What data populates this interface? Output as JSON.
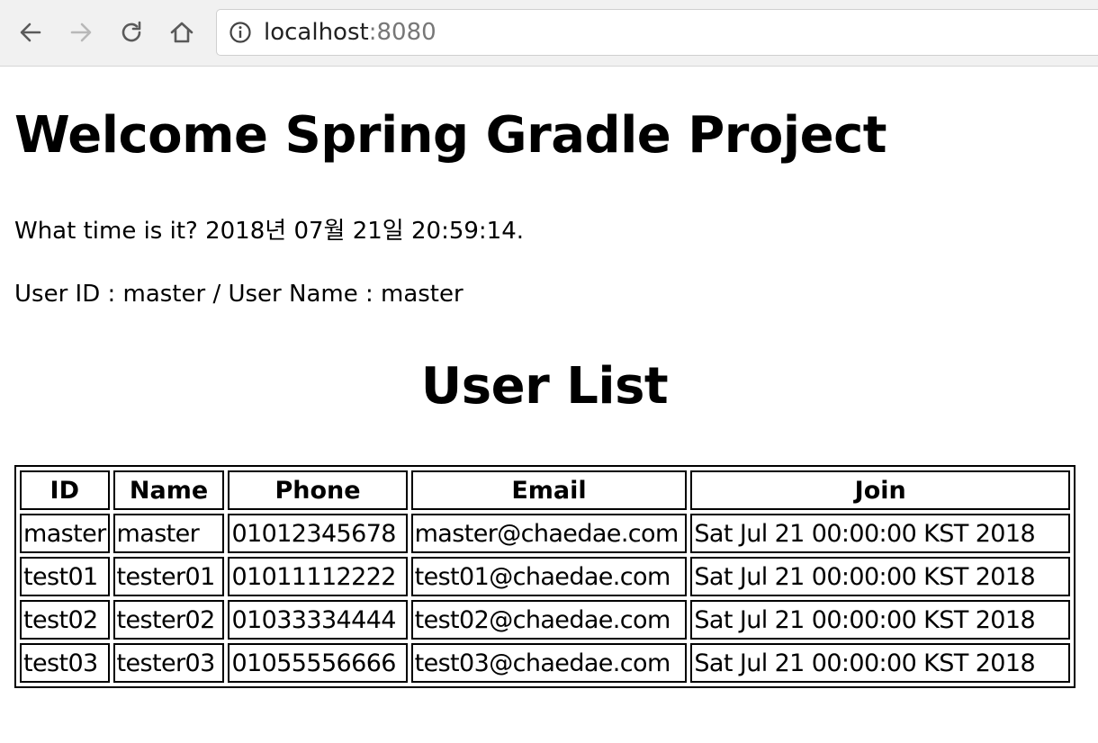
{
  "browser": {
    "url_host": "localhost",
    "url_port": ":8080",
    "icons": [
      "back-arrow-icon",
      "forward-arrow-icon",
      "reload-icon",
      "home-icon",
      "info-icon"
    ]
  },
  "page": {
    "title": "Welcome Spring Gradle Project",
    "time_text": "What time is it? 2018년 07월 21일 20:59:14.",
    "user_text": "User ID : master / User Name : master",
    "list_title": "User List"
  },
  "table": {
    "headers": [
      "ID",
      "Name",
      "Phone",
      "Email",
      "Join"
    ],
    "rows": [
      [
        "master",
        "master",
        "01012345678",
        "master@chaedae.com",
        "Sat Jul 21 00:00:00 KST 2018"
      ],
      [
        "test01",
        "tester01",
        "01011112222",
        "test01@chaedae.com",
        "Sat Jul 21 00:00:00 KST 2018"
      ],
      [
        "test02",
        "tester02",
        "01033334444",
        "test02@chaedae.com",
        "Sat Jul 21 00:00:00 KST 2018"
      ],
      [
        "test03",
        "tester03",
        "01055556666",
        "test03@chaedae.com",
        "Sat Jul 21 00:00:00 KST 2018"
      ]
    ]
  }
}
